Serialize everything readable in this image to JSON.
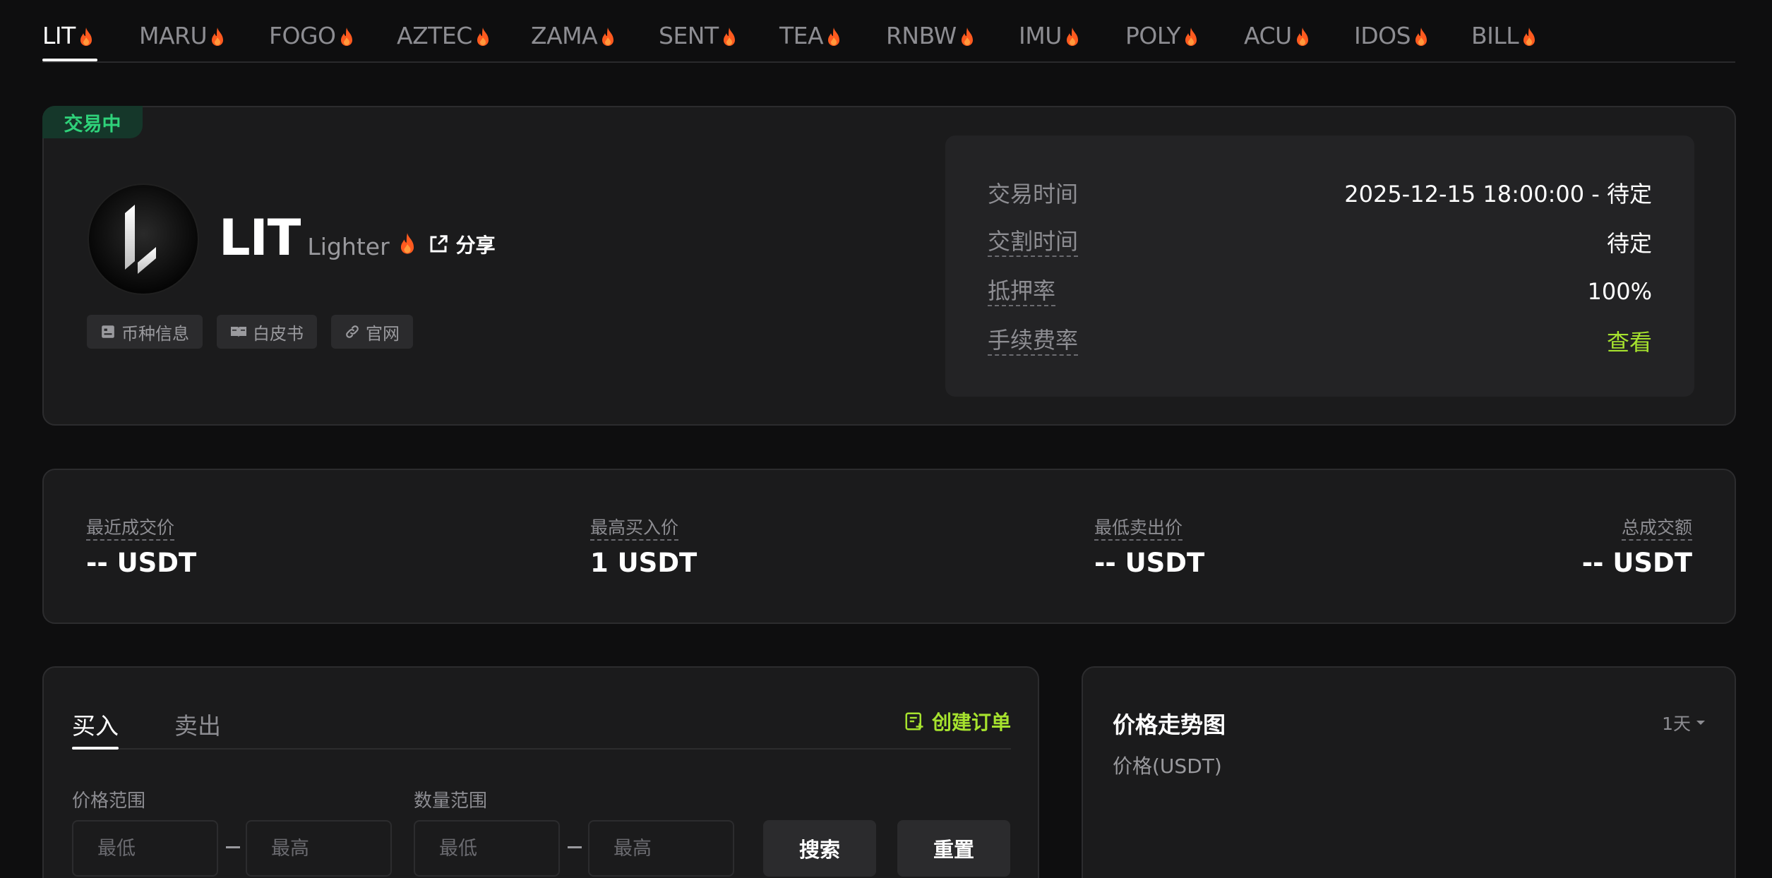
{
  "tabs": [
    {
      "label": "LIT",
      "hot": true
    },
    {
      "label": "MARU",
      "hot": true
    },
    {
      "label": "FOGO",
      "hot": true
    },
    {
      "label": "AZTEC",
      "hot": true
    },
    {
      "label": "ZAMA",
      "hot": true
    },
    {
      "label": "SENT",
      "hot": true
    },
    {
      "label": "TEA",
      "hot": true
    },
    {
      "label": "RNBW",
      "hot": true
    },
    {
      "label": "IMU",
      "hot": true
    },
    {
      "label": "POLY",
      "hot": true
    },
    {
      "label": "ACU",
      "hot": true
    },
    {
      "label": "IDOS",
      "hot": true
    },
    {
      "label": "BILL",
      "hot": true
    }
  ],
  "active_tab": "LIT",
  "token": {
    "status_badge": "交易中",
    "symbol": "LIT",
    "name": "Lighter",
    "share_label": "分享",
    "links": [
      {
        "label": "币种信息",
        "icon": "info-card-icon"
      },
      {
        "label": "白皮书",
        "icon": "book-icon"
      },
      {
        "label": "官网",
        "icon": "link-icon"
      }
    ]
  },
  "details": [
    {
      "label": "交易时间",
      "value": "2025-12-15 18:00:00 - 待定",
      "dashed": false
    },
    {
      "label": "交割时间",
      "value": "待定",
      "dashed": true
    },
    {
      "label": "抵押率",
      "value": "100%",
      "dashed": true
    },
    {
      "label": "手续费率",
      "value": "查看",
      "dashed": true,
      "is_link": true
    }
  ],
  "stats": [
    {
      "label": "最近成交价",
      "value": "-- USDT"
    },
    {
      "label": "最高买入价",
      "value": "1 USDT"
    },
    {
      "label": "最低卖出价",
      "value": "-- USDT"
    },
    {
      "label": "总成交额",
      "value": "-- USDT"
    }
  ],
  "order": {
    "tabs": [
      "买入",
      "卖出"
    ],
    "active": "买入",
    "create_label": "创建订单",
    "price_range_label": "价格范围",
    "qty_range_label": "数量范围",
    "min_placeholder": "最低",
    "max_placeholder": "最高",
    "search_label": "搜索",
    "reset_label": "重置"
  },
  "chart": {
    "title": "价格走势图",
    "range": "1天",
    "unit_label": "价格(USDT)"
  },
  "colors": {
    "background": "#0e0e0f",
    "card": "#1b1b1c",
    "accent_green": "#a6e22e",
    "badge_green": "#2fd27a",
    "flame": "#ff5a1f"
  }
}
